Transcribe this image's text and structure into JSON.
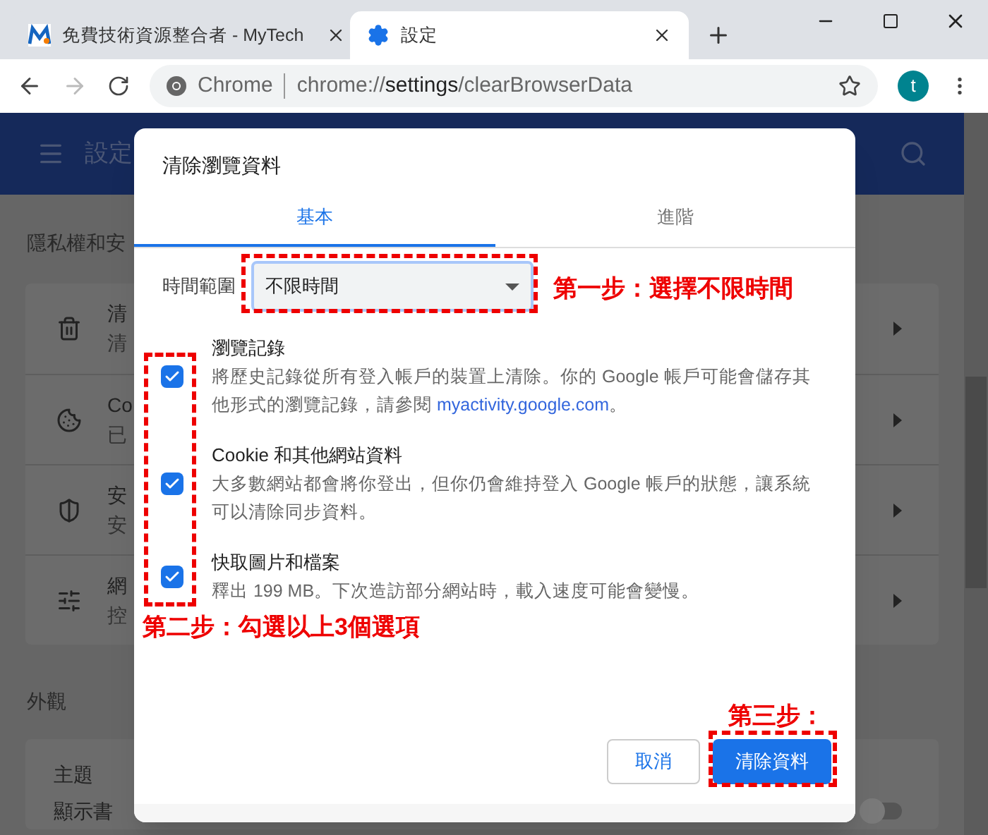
{
  "browser": {
    "tabs": [
      {
        "title": "免費技術資源整合者 - MyTech",
        "selected": false
      },
      {
        "title": "設定",
        "selected": true
      }
    ],
    "address": {
      "label": "Chrome",
      "url_start": "chrome://",
      "url_host": "settings",
      "url_end": "/clearBrowserData"
    },
    "avatar": "t"
  },
  "settings": {
    "title": "設定",
    "sections": [
      {
        "heading": "隱私權和安",
        "rows": [
          {
            "title": "清",
            "subtitle": "清"
          },
          {
            "title": "Co",
            "subtitle": "已"
          },
          {
            "title": "安",
            "subtitle": "安"
          },
          {
            "title": "網",
            "subtitle": "控"
          }
        ]
      },
      {
        "heading": "外觀",
        "rows": [
          {
            "title": "主題"
          },
          {
            "title": "顯示書",
            "on": false
          }
        ]
      }
    ]
  },
  "dialog": {
    "title": "清除瀏覽資料",
    "tabs": [
      {
        "label": "基本",
        "selected": true
      },
      {
        "label": "進階",
        "selected": false
      }
    ],
    "time_range": {
      "label": "時間範圍",
      "value": "不限時間"
    },
    "options": [
      {
        "title": "瀏覽記錄",
        "description": "將歷史記錄從所有登入帳戶的裝置上清除。你的 Google 帳戶可能會儲存其他形式的瀏覽記錄，請參閱 ",
        "link": "myactivity.google.com",
        "after": "。",
        "checked": true
      },
      {
        "title": "Cookie 和其他網站資料",
        "description": "大多數網站都會將你登出，但你仍會維持登入 Google 帳戶的狀態，讓系統可以清除同步資料。",
        "checked": true
      },
      {
        "title": "快取圖片和檔案",
        "description": "釋出 199 MB。下次造訪部分網站時，載入速度可能會變慢。",
        "checked": true
      }
    ],
    "buttons": {
      "cancel": "取消",
      "confirm": "清除資料"
    }
  },
  "annotations": [
    "第一步：選擇不限時間",
    "第二步：勾選以上3個選項",
    "第三步："
  ]
}
